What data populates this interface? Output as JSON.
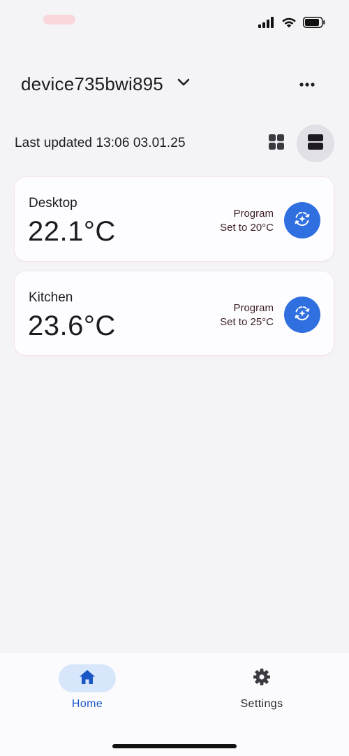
{
  "status_bar": {
    "icons": [
      "cellular-signal-icon",
      "wifi-icon",
      "battery-icon"
    ]
  },
  "header": {
    "device_name": "device735bwi895",
    "dropdown_icon": "chevron-down-icon",
    "more_icon": "more-horizontal-icon"
  },
  "update_row": {
    "last_updated": "Last updated 13:06 03.01.25",
    "grid_view_icon": "grid-view-icon",
    "list_view_icon": "list-view-icon",
    "active_view": "list"
  },
  "rooms": [
    {
      "name": "Desktop",
      "temperature": "22.1°C",
      "program_label": "Program",
      "program_setpoint": "Set to 20°C",
      "program_icon": "program-schedule-icon"
    },
    {
      "name": "Kitchen",
      "temperature": "23.6°C",
      "program_label": "Program",
      "program_setpoint": "Set to 25°C",
      "program_icon": "program-schedule-icon"
    }
  ],
  "bottom_nav": {
    "items": [
      {
        "label": "Home",
        "icon": "home-icon",
        "active": true
      },
      {
        "label": "Settings",
        "icon": "gear-icon",
        "active": false
      }
    ]
  },
  "colors": {
    "accent": "#2f6fe0",
    "active_nav_bg": "#d8e6fb",
    "active_nav_text": "#1a57c5",
    "background": "#f4f3f6",
    "card": "#fdfcff"
  }
}
